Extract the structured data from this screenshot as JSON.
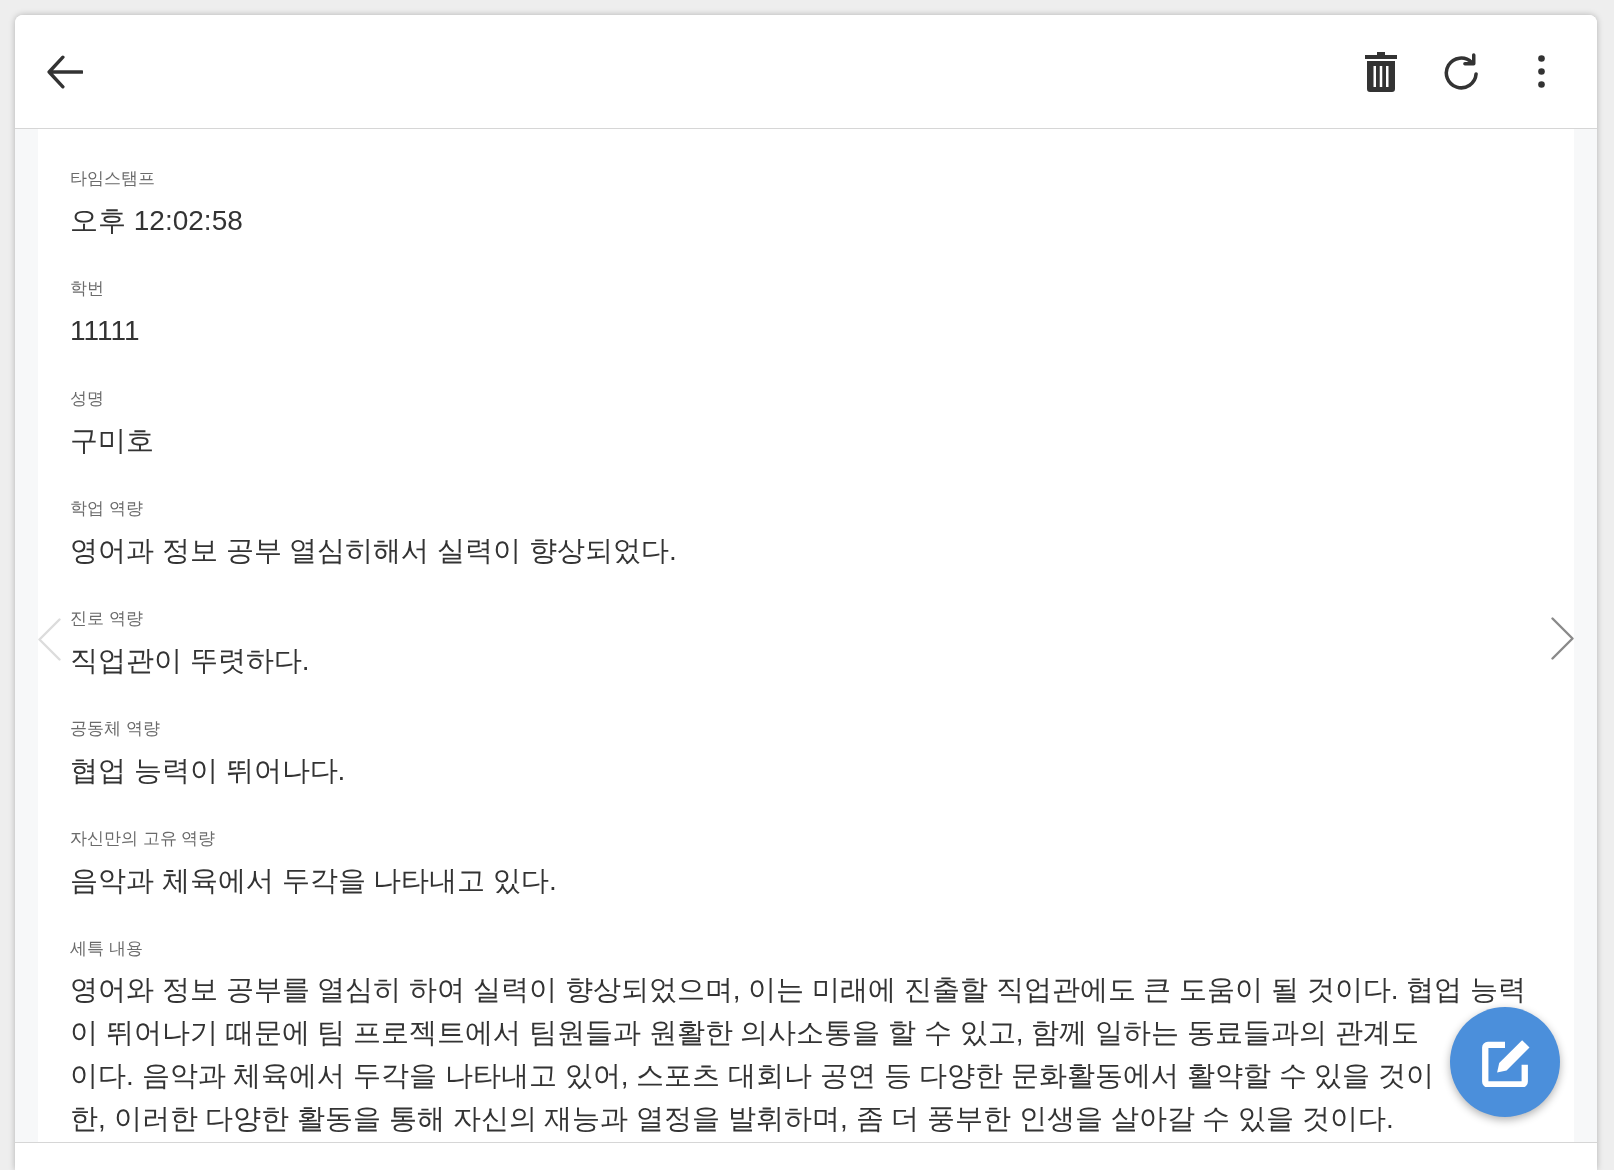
{
  "fields": [
    {
      "label": "타임스탬프",
      "value": "오후 12:02:58"
    },
    {
      "label": "학번",
      "value": "11111"
    },
    {
      "label": "성명",
      "value": "구미호"
    },
    {
      "label": "학업 역량",
      "value": "영어과 정보 공부 열심히해서 실력이 향상되었다."
    },
    {
      "label": "진로 역량",
      "value": "직업관이 뚜렷하다."
    },
    {
      "label": "공동체 역량",
      "value": "협업 능력이 뛰어나다."
    },
    {
      "label": "자신만의 고유 역량",
      "value": "음악과 체육에서 두각을 나타내고 있다."
    },
    {
      "label": "세특 내용",
      "value": "영어와 정보 공부를 열심히 하여 실력이 향상되었으며, 이는 미래에 진출할 직업관에도 큰 도움이 될 것이다. 협업 능력\n이 뛰어나기 때문에 팀 프로젝트에서 팀원들과 원활한 의사소통을 할 수 있고, 함께 일하는 동료들과의 관계도\n이다. 음악과 체육에서 두각을 나타내고 있어, 스포츠 대회나 공연 등 다양한 문화활동에서 활약할 수 있을 것이\n한, 이러한 다양한 활동을 통해 자신의 재능과 열정을 발휘하며, 좀 더 풍부한 인생을 살아갈 수 있을 것이다."
    }
  ],
  "pager": {
    "previous": {
      "disabled": true
    },
    "next": {
      "disabled": false
    }
  }
}
